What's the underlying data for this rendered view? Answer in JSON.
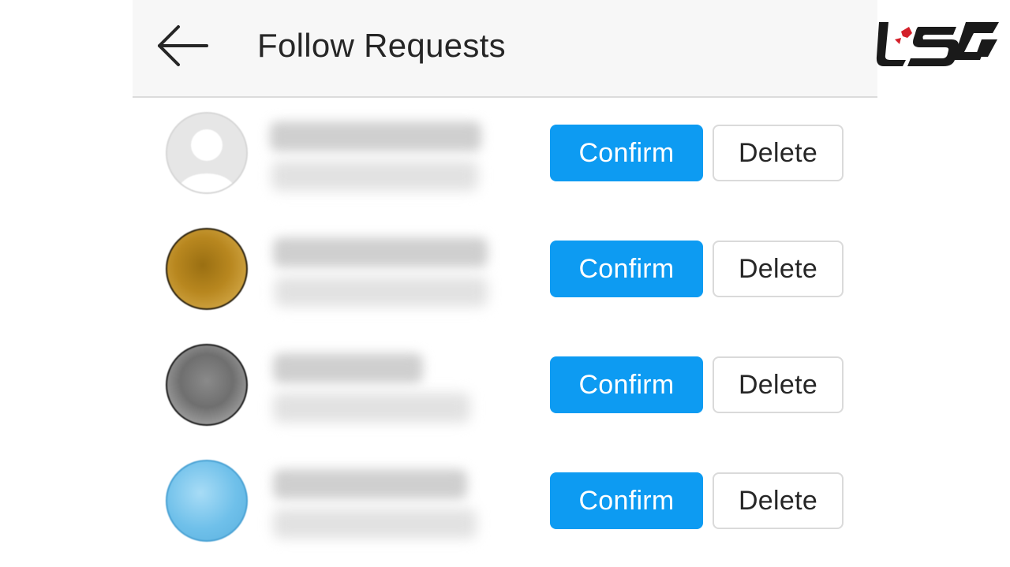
{
  "header": {
    "title": "Follow Requests",
    "back_icon": "arrow-left-icon"
  },
  "logo": {
    "name": "site-logo",
    "colors": {
      "ink": "#1a1a1a",
      "accent": "#d4202a"
    }
  },
  "buttons": {
    "confirm_color": "#0d9bf2",
    "delete_border": "#dadada"
  },
  "requests": [
    {
      "confirm_label": "Confirm",
      "delete_label": "Delete",
      "avatar": "default-avatar-icon",
      "avatar_color": "#e6e6e6"
    },
    {
      "confirm_label": "Confirm",
      "delete_label": "Delete",
      "avatar": "photo-avatar",
      "avatar_color": "#b8871f"
    },
    {
      "confirm_label": "Confirm",
      "delete_label": "Delete",
      "avatar": "photo-avatar",
      "avatar_color": "#6f6f6f"
    },
    {
      "confirm_label": "Confirm",
      "delete_label": "Delete",
      "avatar": "photo-avatar",
      "avatar_color": "#6fc0ea"
    }
  ]
}
